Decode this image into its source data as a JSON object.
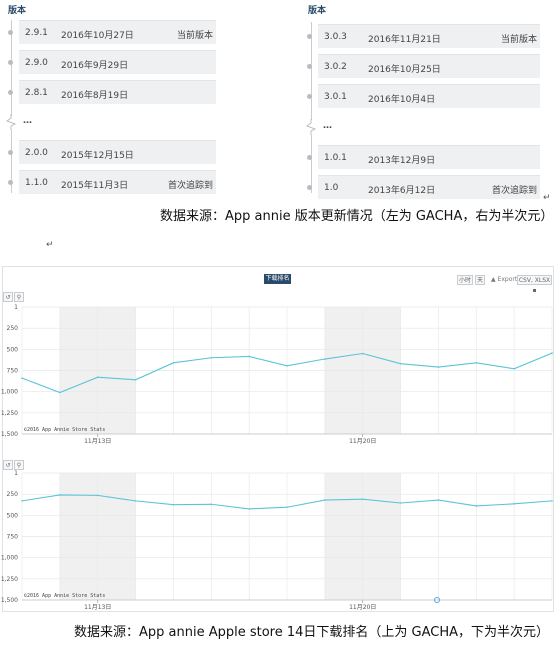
{
  "left_versions": {
    "heading": "版本",
    "rows_top": [
      {
        "version": "2.9.1",
        "date": "2016年10月27日",
        "note": "当前版本"
      },
      {
        "version": "2.9.0",
        "date": "2016年9月29日",
        "note": ""
      },
      {
        "version": "2.8.1",
        "date": "2016年8月19日",
        "note": ""
      }
    ],
    "ellipsis": "…",
    "rows_bottom": [
      {
        "version": "2.0.0",
        "date": "2015年12月15日",
        "note": ""
      },
      {
        "version": "1.1.0",
        "date": "2015年11月3日",
        "note": "首次追踪到"
      }
    ]
  },
  "right_versions": {
    "heading": "版本",
    "rows_top": [
      {
        "version": "3.0.3",
        "date": "2016年11月21日",
        "note": "当前版本"
      },
      {
        "version": "3.0.2",
        "date": "2016年10月25日",
        "note": ""
      },
      {
        "version": "3.0.1",
        "date": "2016年10月4日",
        "note": ""
      }
    ],
    "ellipsis": "…",
    "rows_bottom": [
      {
        "version": "1.0.1",
        "date": "2013年12月9日",
        "note": ""
      },
      {
        "version": "1.0",
        "date": "2013年6月12日",
        "note": "首次追踪到"
      }
    ]
  },
  "return_mark": "↵",
  "caption_top": "数据来源：App annie 版本更新情况（左为 GACHA，右为半次元）",
  "caption_bottom": "数据来源：App annie Apple store 14日下载排名（上为 GACHA，下为半次元）",
  "toolbar": {
    "tab_label": "下载排名",
    "hour_label": "小时",
    "day_label": "天",
    "export_label": "Export",
    "csv_label": "CSV, XLSX"
  },
  "chart_data": [
    {
      "type": "line",
      "title": "",
      "series_color": "#5bc4d6",
      "x_tick_labels": [
        "11月13日",
        "11月20日"
      ],
      "y_tick_labels": [
        "1",
        "250",
        "500",
        "750",
        "1,000",
        "1,250",
        "1,500"
      ],
      "ylim": [
        1500,
        1
      ],
      "y_inverted": true,
      "grid": true,
      "watermark": "©2016 App Annie Store Stats",
      "shaded_weekends": [
        [
          1,
          3
        ],
        [
          8,
          10
        ]
      ],
      "x_count": 15,
      "values": [
        840,
        1010,
        830,
        860,
        660,
        600,
        585,
        695,
        615,
        550,
        670,
        710,
        660,
        730,
        545
      ]
    },
    {
      "type": "line",
      "title": "",
      "series_color": "#5bc4d6",
      "x_tick_labels": [
        "11月13日",
        "11月20日"
      ],
      "y_tick_labels": [
        "1",
        "250",
        "500",
        "750",
        "1,000",
        "1,250",
        "1,500"
      ],
      "ylim": [
        1500,
        1
      ],
      "y_inverted": true,
      "grid": true,
      "watermark": "©2016 App Annie Store Stats",
      "shaded_weekends": [
        [
          1,
          3
        ],
        [
          8,
          10
        ]
      ],
      "x_count": 15,
      "values": [
        330,
        260,
        265,
        330,
        375,
        370,
        425,
        405,
        320,
        310,
        355,
        320,
        390,
        365,
        330
      ]
    }
  ]
}
